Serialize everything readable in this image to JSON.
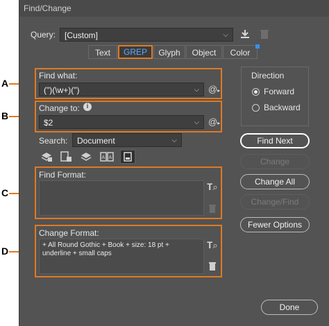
{
  "window": {
    "title": "Find/Change"
  },
  "query": {
    "label": "Query:",
    "value": "[Custom]"
  },
  "tabs": [
    {
      "label": "Text",
      "active": false
    },
    {
      "label": "GREP",
      "active": true
    },
    {
      "label": "Glyph",
      "active": false
    },
    {
      "label": "Object",
      "active": false
    },
    {
      "label": "Color",
      "active": false
    }
  ],
  "find_what": {
    "label": "Find what:",
    "value": "(\")(\\w+)(\")"
  },
  "change_to": {
    "label": "Change to:",
    "value": "$2"
  },
  "search": {
    "label": "Search:",
    "value": "Document"
  },
  "find_format": {
    "label": "Find Format:",
    "value": ""
  },
  "change_format": {
    "label": "Change Format:",
    "value": "+ All Round Gothic + Book + size: 18 pt + underline + small caps"
  },
  "direction": {
    "label": "Direction",
    "options": [
      "Forward",
      "Backward"
    ],
    "selected": "Forward"
  },
  "buttons": {
    "find_next": "Find Next",
    "change": "Change",
    "change_all": "Change All",
    "change_find": "Change/Find",
    "fewer_options": "Fewer Options",
    "done": "Done"
  },
  "callouts": [
    "A",
    "B",
    "C",
    "D"
  ],
  "colors": {
    "accent": "#e07a20",
    "active_tab_text": "#5ea8ff",
    "dialog_bg": "#535353"
  }
}
